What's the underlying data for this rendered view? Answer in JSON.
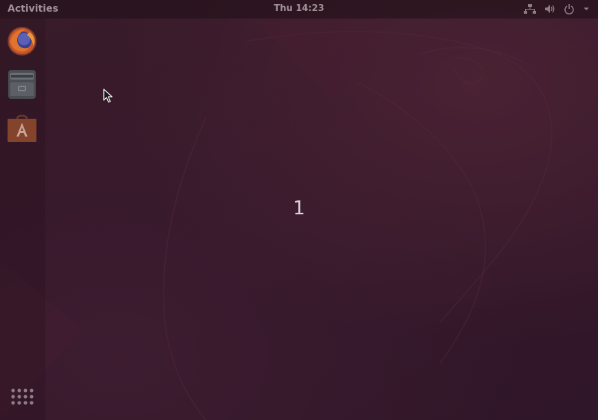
{
  "topbar": {
    "activities_label": "Activities",
    "clock": "Thu 14:23",
    "tray_icons": [
      "network-icon",
      "volume-icon",
      "power-icon",
      "chevron-down-icon"
    ]
  },
  "dock": {
    "items": [
      {
        "name": "Firefox",
        "icon": "firefox-icon"
      },
      {
        "name": "Files",
        "icon": "files-icon"
      },
      {
        "name": "Ubuntu Software",
        "icon": "software-center-icon"
      }
    ],
    "show_apps_icon": "app-grid-icon"
  },
  "workspace": {
    "number": "1"
  },
  "colors": {
    "wallpaper": "#33182a",
    "topbar_text": "#a08f98"
  }
}
